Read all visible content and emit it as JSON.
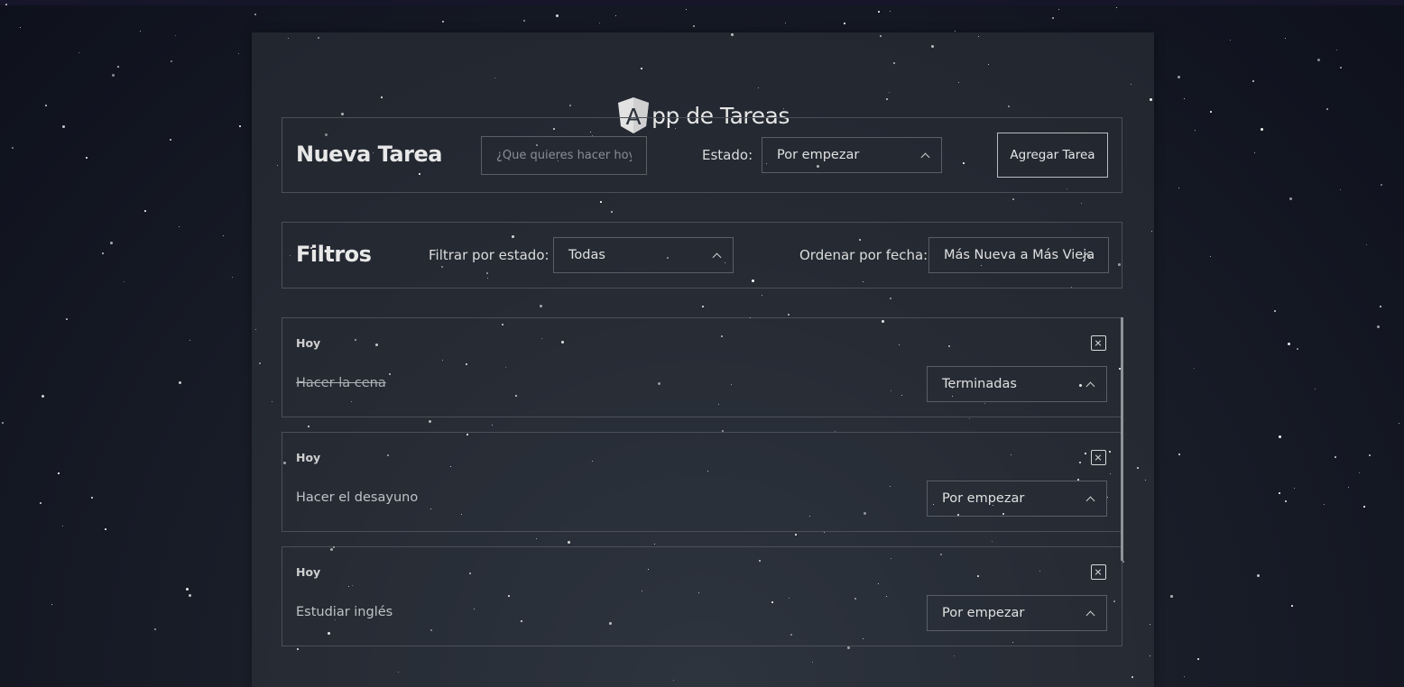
{
  "app": {
    "title": "pp de Tareas",
    "logo_letter": "A",
    "logo_icon": "angular-shield-icon"
  },
  "new_task": {
    "heading": "Nueva Tarea",
    "input_placeholder": "¿Que quieres hacer hoy?",
    "input_value": "",
    "status_label": "Estado:",
    "status_selected": "Por empezar",
    "add_button": "Agregar Tarea"
  },
  "filters": {
    "heading": "Filtros",
    "filter_label": "Filtrar por estado:",
    "filter_selected": "Todas",
    "sort_label": "Ordenar por fecha:",
    "sort_selected": "Más Nueva a Más Vieja"
  },
  "tasks": [
    {
      "date": "Hoy",
      "name": "Hacer la cena",
      "status": "Terminadas",
      "completed": true
    },
    {
      "date": "Hoy",
      "name": "Hacer el desayuno",
      "status": "Por empezar",
      "completed": false
    },
    {
      "date": "Hoy",
      "name": "Estudiar inglés",
      "status": "Por empezar",
      "completed": false
    }
  ]
}
